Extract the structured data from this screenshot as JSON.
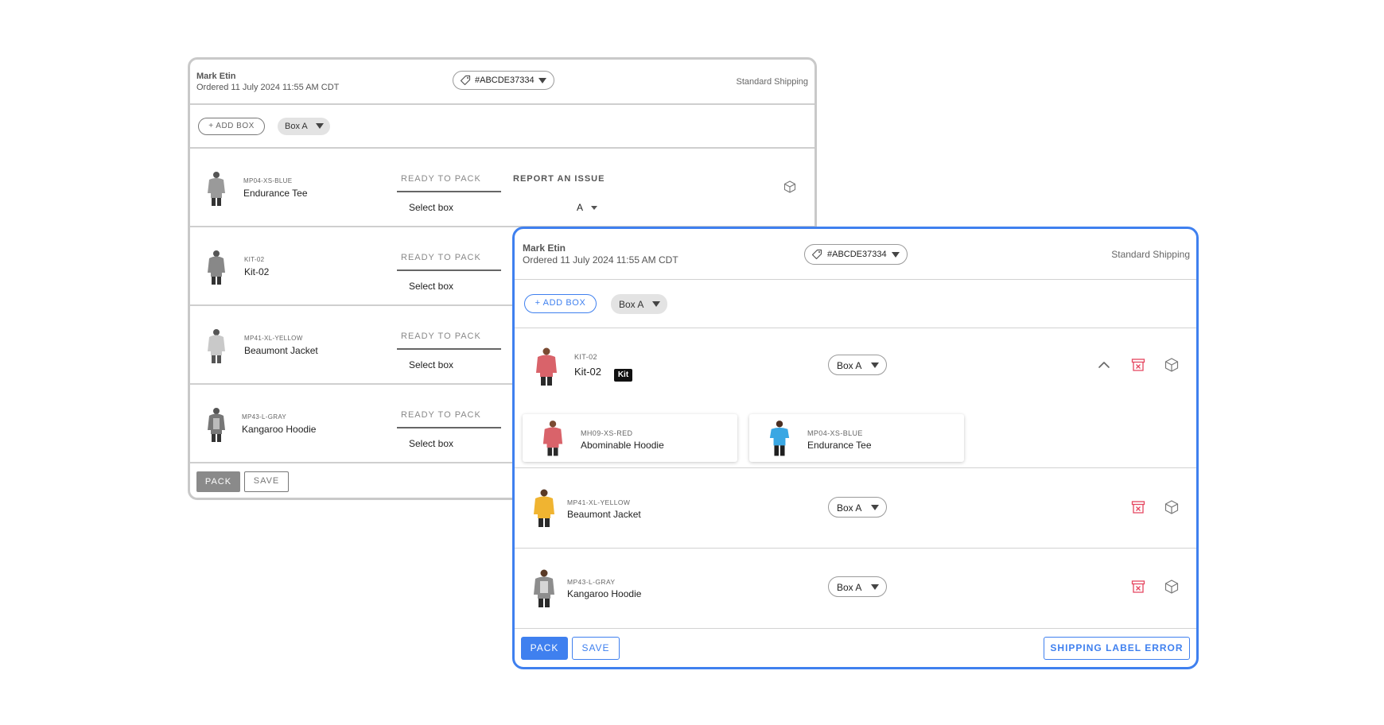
{
  "colors": {
    "accent": "#3f80ef",
    "danger": "#e5455f",
    "muted": "#8a8a8a"
  },
  "back_card": {
    "customer_name": "Mark Etin",
    "ordered": "Ordered 11 July 2024 11:55 AM CDT",
    "order_id": "#ABCDE37334",
    "shipping": "Standard Shipping",
    "add_box": "+ ADD BOX",
    "box_select": "Box A",
    "items": [
      {
        "sku": "MP04-XS-BLUE",
        "name": "Endurance Tee",
        "status_tab": "READY TO PACK",
        "issue_tab": "REPORT AN ISSUE",
        "select_label": "Select box",
        "box_value": "A",
        "icon": "cube-icon"
      },
      {
        "sku": "KIT-02",
        "name": "Kit-02",
        "status_tab": "READY TO PACK",
        "select_label": "Select box"
      },
      {
        "sku": "MP41-XL-YELLOW",
        "name": "Beaumont Jacket",
        "status_tab": "READY TO PACK",
        "select_label": "Select box"
      },
      {
        "sku": "MP43-L-GRAY",
        "name": "Kangaroo Hoodie",
        "status_tab": "READY TO PACK",
        "select_label": "Select box"
      }
    ],
    "pack": "PACK",
    "save": "SAVE"
  },
  "front_card": {
    "customer_name": "Mark Etin",
    "ordered": "Ordered 11 July 2024 11:55 AM CDT",
    "order_id": "#ABCDE37334",
    "shipping": "Standard Shipping",
    "add_box": "+ ADD BOX",
    "box_select": "Box A",
    "kit": {
      "sku": "KIT-02",
      "name": "Kit-02",
      "badge": "Kit",
      "box": "Box A",
      "icons": [
        "chevron-up-icon",
        "remove-box-icon",
        "cube-icon"
      ],
      "components": [
        {
          "sku": "MH09-XS-RED",
          "name": "Abominable Hoodie",
          "color": "#d9636a"
        },
        {
          "sku": "MP04-XS-BLUE",
          "name": "Endurance Tee",
          "color": "#3aa7e3"
        }
      ]
    },
    "items": [
      {
        "sku": "MP41-XL-YELLOW",
        "name": "Beaumont Jacket",
        "box": "Box A",
        "color": "#f0b431"
      },
      {
        "sku": "MP43-L-GRAY",
        "name": "Kangaroo Hoodie",
        "box": "Box A",
        "color": "#8d8d8d"
      }
    ],
    "pack": "PACK",
    "save": "SAVE",
    "error_button": "SHIPPING LABEL ERROR"
  }
}
